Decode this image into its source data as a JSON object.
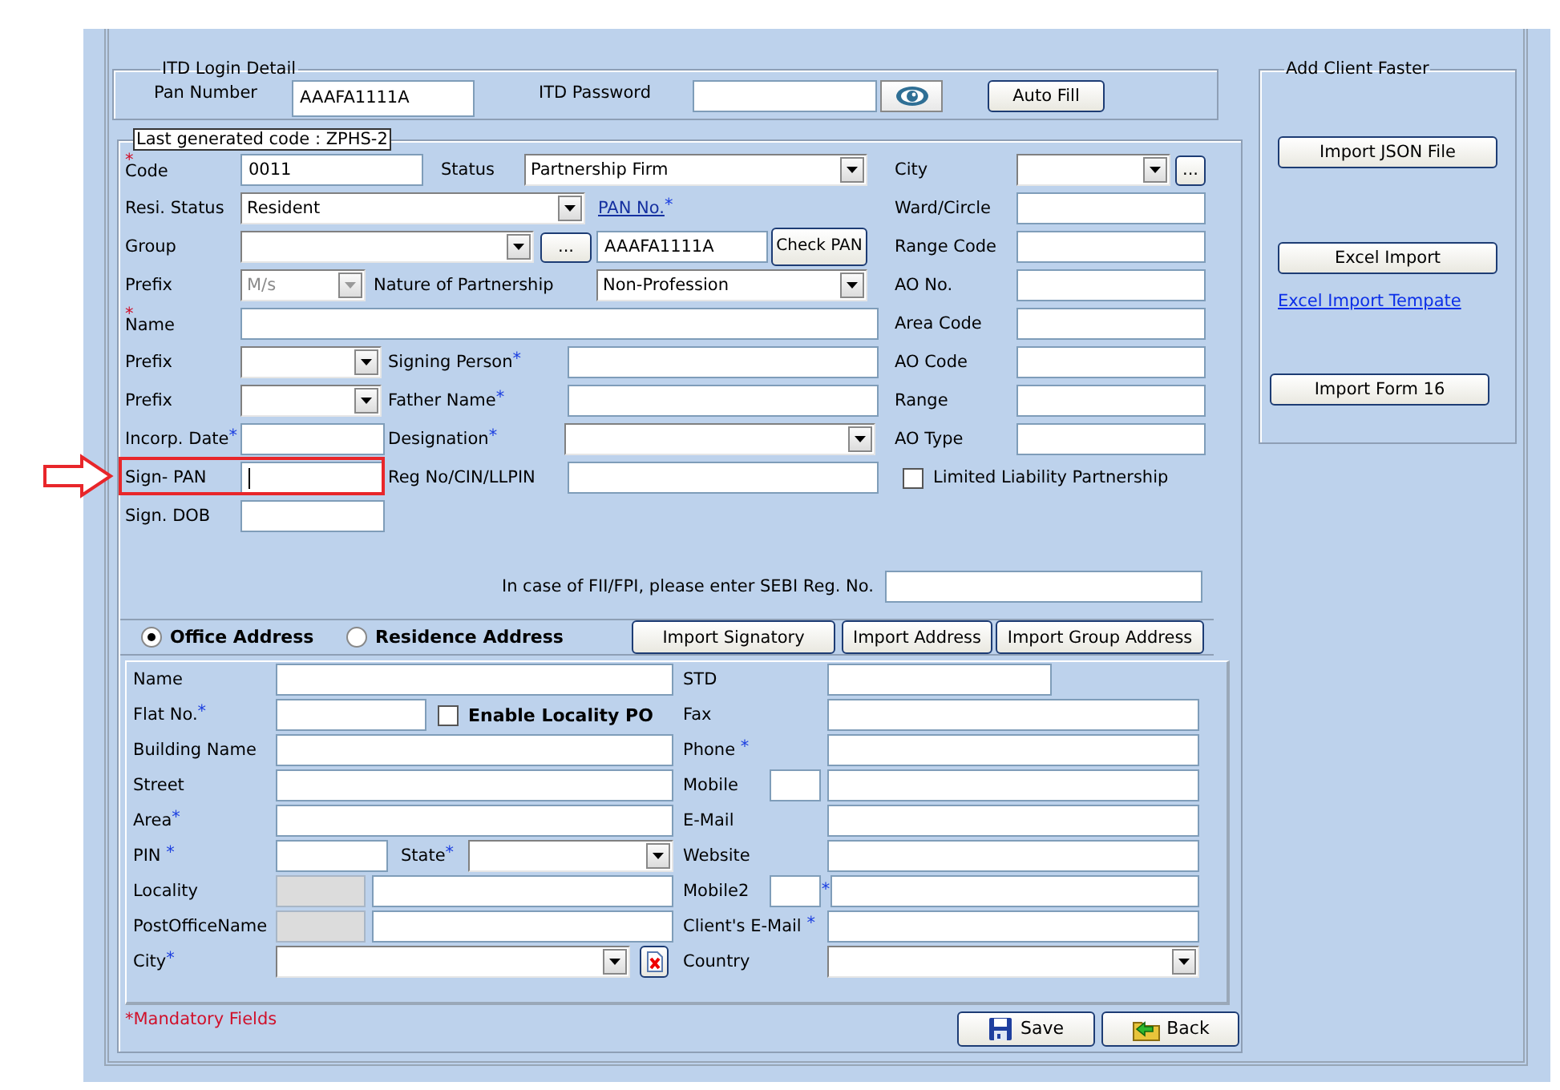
{
  "itd_login": {
    "title": "ITD Login Detail",
    "pan_label": "Pan Number",
    "pan_value": "AAAFA1111A",
    "password_label": "ITD Password",
    "auto_fill": "Auto Fill"
  },
  "client": {
    "legend": "Last generated code : ZPHS-2",
    "left_rows": [
      [
        {
          "kind": "label",
          "text": "Code",
          "star_above": "*"
        },
        {
          "kind": "input",
          "value": "0011",
          "disabled": false
        },
        {
          "kind": "label",
          "text": "Status"
        },
        {
          "kind": "select",
          "value": "Partnership Firm",
          "disabled": false
        }
      ],
      [
        {
          "kind": "label",
          "text": "Resi. Status"
        },
        {
          "kind": "select",
          "value": "Resident",
          "disabled": false
        },
        {
          "kind": "link",
          "text": "PAN No.",
          "star": "*"
        }
      ],
      [
        {
          "kind": "label",
          "text": "Group"
        },
        {
          "kind": "select",
          "disabled": false
        },
        {
          "kind": "ellipsis_button",
          "text": "..."
        },
        {
          "kind": "input",
          "value": "AAAFA1111A",
          "disabled": false
        },
        {
          "kind": "button",
          "text": "Check PAN"
        }
      ],
      [
        {
          "kind": "label",
          "text": "Prefix"
        },
        {
          "kind": "select",
          "value": "M/s",
          "disabled": true
        },
        {
          "kind": "label",
          "text": "Nature of Partnership"
        },
        {
          "kind": "select",
          "value": "Non-Profession",
          "disabled": false
        }
      ],
      [
        {
          "kind": "label",
          "text": "Name",
          "star_above": "*"
        },
        {
          "kind": "input",
          "disabled": false
        }
      ],
      [
        {
          "kind": "label",
          "text": "Prefix"
        },
        {
          "kind": "select",
          "disabled": false
        },
        {
          "kind": "label",
          "text": "Signing Person",
          "star": "*"
        },
        {
          "kind": "input",
          "disabled": false
        }
      ],
      [
        {
          "kind": "label",
          "text": "Prefix"
        },
        {
          "kind": "select",
          "disabled": false
        },
        {
          "kind": "label",
          "text": "Father Name",
          "star": "*"
        },
        {
          "kind": "input",
          "disabled": false
        }
      ],
      [
        {
          "kind": "label",
          "text": "Incorp. Date",
          "star": "*"
        },
        {
          "kind": "input",
          "disabled": false
        },
        {
          "kind": "label",
          "text": "Designation",
          "star": "*"
        },
        {
          "kind": "select",
          "disabled": false
        }
      ],
      [
        {
          "kind": "label",
          "text": "Sign- PAN"
        },
        {
          "kind": "input",
          "disabled": false,
          "focused": true
        },
        {
          "kind": "label",
          "text": "Reg No/CIN/LLPIN"
        },
        {
          "kind": "input",
          "disabled": false
        }
      ],
      [
        {
          "kind": "label",
          "text": "Sign. DOB"
        },
        {
          "kind": "input",
          "disabled": false
        }
      ]
    ],
    "right_rows": [
      [
        {
          "kind": "label",
          "text": "City"
        },
        {
          "kind": "select",
          "disabled": false
        },
        {
          "kind": "ellipsis_button",
          "text": "..."
        }
      ],
      [
        {
          "kind": "label",
          "text": "Ward/Circle"
        },
        {
          "kind": "input",
          "disabled": false
        }
      ],
      [
        {
          "kind": "label",
          "text": "Range Code"
        },
        {
          "kind": "input",
          "disabled": false
        }
      ],
      [
        {
          "kind": "label",
          "text": "AO No."
        },
        {
          "kind": "input",
          "disabled": false
        }
      ],
      [
        {
          "kind": "label",
          "text": "Area Code"
        },
        {
          "kind": "input",
          "disabled": false
        }
      ],
      [
        {
          "kind": "label",
          "text": "AO Code"
        },
        {
          "kind": "input",
          "disabled": false
        }
      ],
      [
        {
          "kind": "label",
          "text": "Range"
        },
        {
          "kind": "input",
          "disabled": false
        }
      ],
      [
        {
          "kind": "label",
          "text": "AO Type"
        },
        {
          "kind": "input",
          "disabled": false
        }
      ],
      [
        {
          "kind": "checkbox",
          "label": "Limited Liability Partnership",
          "checked": false
        }
      ]
    ],
    "sebi_label": "In case of FII/FPI, please enter SEBI Reg. No."
  },
  "address": {
    "tabs": [
      {
        "label": "Office Address",
        "selected": true
      },
      {
        "label": "Residence Address",
        "selected": false
      }
    ],
    "buttons": [
      "Import Signatory",
      "Import Address",
      "Import Group Address"
    ],
    "left_rows": [
      [
        {
          "kind": "label",
          "text": "Name"
        },
        {
          "kind": "input",
          "disabled": false
        }
      ],
      [
        {
          "kind": "label",
          "text": "Flat No.",
          "star": "*"
        },
        {
          "kind": "input",
          "disabled": false
        },
        {
          "kind": "checkbox",
          "label": "Enable Locality PO",
          "checked": false
        }
      ],
      [
        {
          "kind": "label",
          "text": "Building Name"
        },
        {
          "kind": "input",
          "disabled": false
        }
      ],
      [
        {
          "kind": "label",
          "text": "Street"
        },
        {
          "kind": "input",
          "disabled": false
        }
      ],
      [
        {
          "kind": "label",
          "text": "Area",
          "star": "*"
        },
        {
          "kind": "input",
          "disabled": false
        }
      ],
      [
        {
          "kind": "label",
          "text": "PIN  ",
          "star": "*"
        },
        {
          "kind": "input",
          "disabled": false
        },
        {
          "kind": "label",
          "text": "State",
          "star": "*"
        },
        {
          "kind": "select",
          "disabled": false
        }
      ],
      [
        {
          "kind": "label",
          "text": "Locality"
        },
        {
          "kind": "input",
          "disabled": true
        },
        {
          "kind": "input",
          "disabled": false
        }
      ],
      [
        {
          "kind": "label",
          "text": "PostOfficeName"
        },
        {
          "kind": "input",
          "disabled": true
        },
        {
          "kind": "input",
          "disabled": false
        }
      ],
      [
        {
          "kind": "label",
          "text": "City",
          "star": "*"
        },
        {
          "kind": "select",
          "disabled": false
        },
        {
          "kind": "clear_button"
        }
      ]
    ],
    "right_rows": [
      [
        {
          "kind": "label",
          "text": "STD"
        },
        {
          "kind": "input",
          "disabled": false
        }
      ],
      [
        {
          "kind": "label",
          "text": "Fax"
        },
        {
          "kind": "input",
          "disabled": false
        }
      ],
      [
        {
          "kind": "label",
          "text": "Phone ",
          "star": "*"
        },
        {
          "kind": "input",
          "disabled": false
        }
      ],
      [
        {
          "kind": "label",
          "text": "Mobile"
        },
        {
          "kind": "input",
          "disabled": false
        },
        {
          "kind": "input",
          "disabled": false
        }
      ],
      [
        {
          "kind": "label",
          "text": "E-Mail"
        },
        {
          "kind": "input",
          "disabled": false
        }
      ],
      [
        {
          "kind": "label",
          "text": "Website"
        },
        {
          "kind": "input",
          "disabled": false
        }
      ],
      [
        {
          "kind": "label",
          "text": "Mobile2"
        },
        {
          "kind": "input",
          "disabled": false
        },
        {
          "kind": "star",
          "text": "*"
        },
        {
          "kind": "input",
          "disabled": false
        }
      ],
      [
        {
          "kind": "label",
          "text": "Client's E-Mail ",
          "star": "*"
        },
        {
          "kind": "input",
          "disabled": false
        }
      ],
      [
        {
          "kind": "label",
          "text": "Country"
        },
        {
          "kind": "select",
          "disabled": false
        }
      ]
    ]
  },
  "mandatory_note": "*Mandatory Fields",
  "actions": [
    {
      "kind": "save",
      "label": "Save"
    },
    {
      "kind": "back",
      "label": "Back"
    }
  ],
  "quick_add": {
    "title": "Add Client Faster",
    "items": [
      {
        "kind": "button",
        "text": "Import JSON File"
      },
      {
        "kind": "button",
        "text": "Excel Import"
      },
      {
        "kind": "link",
        "text": "Excel Import Tempate"
      },
      {
        "kind": "button",
        "text": "Import Form 16"
      }
    ]
  }
}
